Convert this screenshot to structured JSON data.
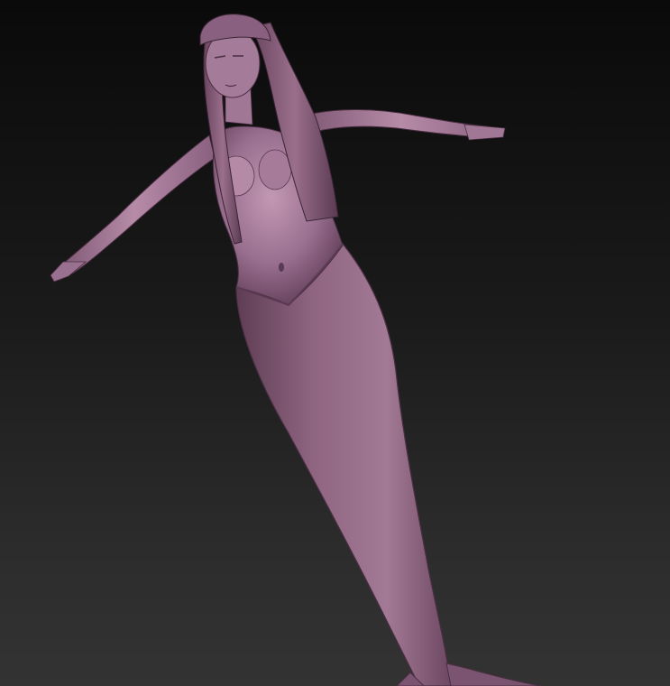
{
  "viewport": {
    "background_top": "#0a0a0a",
    "background_bottom": "#333333"
  },
  "model": {
    "material_base": "#8e6480",
    "material_highlight": "#c9a3bb",
    "material_shadow": "#4a2e42",
    "icon": "sculpted-mermaid-figure"
  }
}
